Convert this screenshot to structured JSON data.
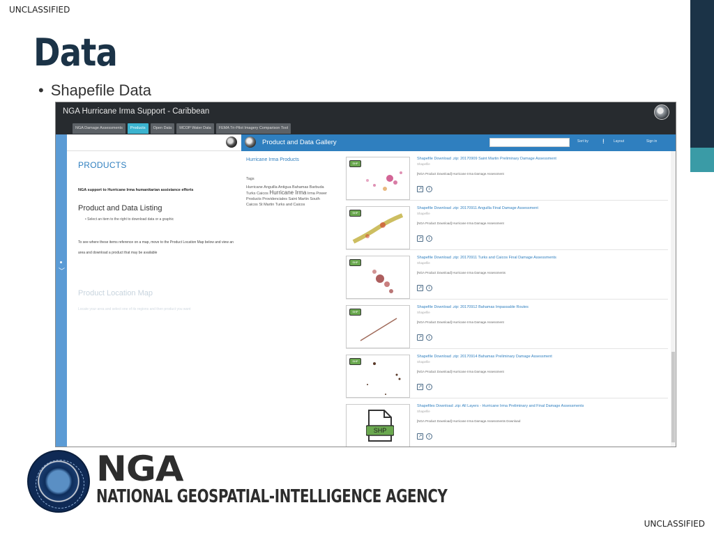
{
  "classification": {
    "top": "UNCLASSIFIED",
    "bottom": "UNCLASSIFIED"
  },
  "slide": {
    "title": "Data",
    "bullet": "Shapefile Data"
  },
  "app": {
    "title": "NGA Hurricane Irma Support - Caribbean",
    "tabs": [
      {
        "label": "NGA Damage Assessments"
      },
      {
        "label": "Products"
      },
      {
        "label": "Open Data"
      },
      {
        "label": "MCOP Water Data"
      },
      {
        "label": "FEMA Tri-Pilot Imagery Comparison Tool"
      }
    ],
    "products_panel": {
      "heading": "PRODUCTS",
      "support_text": "NGA support to Hurricane Irma humanitarian assistance efforts",
      "listing_heading": "Product and Data Listing",
      "listing_hint": "Select an item to the right to download data or a graphic",
      "paragraph": "To see where these items reference on a map, move to the Product Location Map below and view an area and download a product that may be available",
      "map_heading": "Product Location Map",
      "map_sub": "Locate your area and select one of its regions and then product you want"
    },
    "gallery": {
      "title": "Product and Data Gallery",
      "search_placeholder": "",
      "buttons": {
        "sort": "Sort by",
        "layout": "Layout",
        "signin": "Sign in"
      },
      "sidebar_heading": "Hurricane Irma Products",
      "tags_label": "Tags",
      "tags": "Hurricane Anguilla Antigua Bahamas Barbuda Turks Caicos",
      "tags_big": "Hurricane Irma",
      "tags_more": "Irma Power Products Providenciales Saint Martin South Caicos St Martin Turks and Caicos",
      "items": [
        {
          "title": "Shapefile Download .zip: 20170909 Saint Martin Preliminary Damage Assessment",
          "sub": "Shapefile",
          "desc": "[NGA Product Download] Hurricane Irma Damage Assessment"
        },
        {
          "title": "Shapefile Download .zip: 20170911 Anguilla Final Damage Assessment",
          "sub": "Shapefile",
          "desc": "[NGA Product Download] Hurricane Irma Damage Assessment"
        },
        {
          "title": "Shapefile Download .zip: 20170911 Turks and Caicos Final Damage Assessments",
          "sub": "Shapefile",
          "desc": "[NGA Product Download] Hurricane Irma Damage Assessments"
        },
        {
          "title": "Shapefile Download .zip: 20170912 Bahamas Impassable Routes",
          "sub": "Shapefile",
          "desc": "[NGA Product Download] Hurricane Irma Damage Assessment"
        },
        {
          "title": "Shapefile Download .zip: 20170914 Bahamas Preliminary Damage Assessment",
          "sub": "Shapefile",
          "desc": "[NGA Product Download] Hurricane Irma Damage Assessment"
        },
        {
          "title": "Shapefiles Download .zip: All Layers - Hurricane Irma Preliminary and Final Damage Assessments",
          "sub": "Shapefile",
          "desc": "[NGA Product Download] Hurricane Irma Damage Assessments Download"
        }
      ],
      "shp_badge": "SHP"
    }
  },
  "logo": {
    "acronym": "NGA",
    "full_name": "NATIONAL GEOSPATIAL-INTELLIGENCE AGENCY",
    "colors": {
      "brand_dark": "#1b3347",
      "accent_teal": "#3a9ba6",
      "gallery_blue": "#2f7fbf"
    }
  }
}
